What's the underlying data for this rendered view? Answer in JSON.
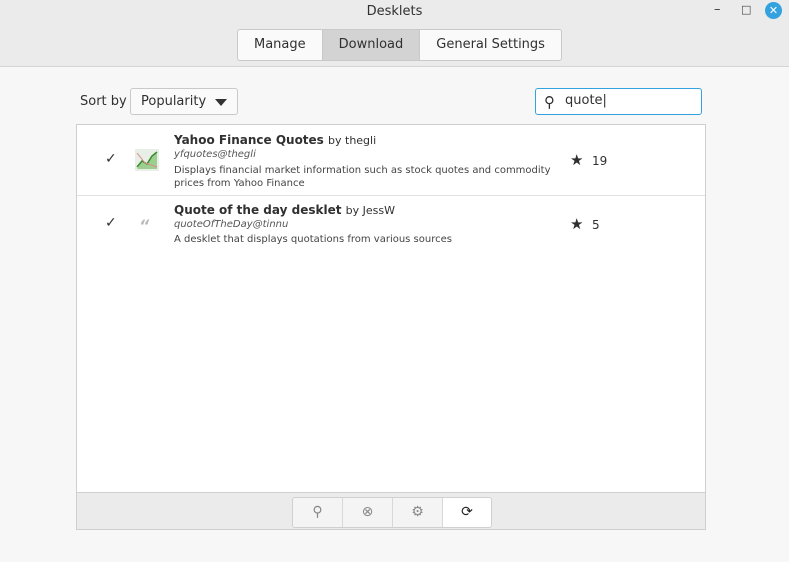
{
  "window": {
    "title": "Desklets"
  },
  "tabs": [
    {
      "label": "Manage"
    },
    {
      "label": "Download"
    },
    {
      "label": "General Settings"
    }
  ],
  "sort": {
    "label": "Sort by",
    "value": "Popularity"
  },
  "search": {
    "value": "quote"
  },
  "items": [
    {
      "name": "Yahoo Finance Quotes",
      "author": "by thegli",
      "uuid": "yfquotes@thegli",
      "description": "Displays financial market information such as stock quotes and commodity prices from Yahoo Finance",
      "score": "19"
    },
    {
      "name": "Quote of the day desklet",
      "author": "by JessW",
      "uuid": "quoteOfTheDay@tinnu",
      "description": "A desklet that displays quotations from various sources",
      "score": "5"
    }
  ],
  "colors": {
    "accent": "#35a2e0"
  }
}
